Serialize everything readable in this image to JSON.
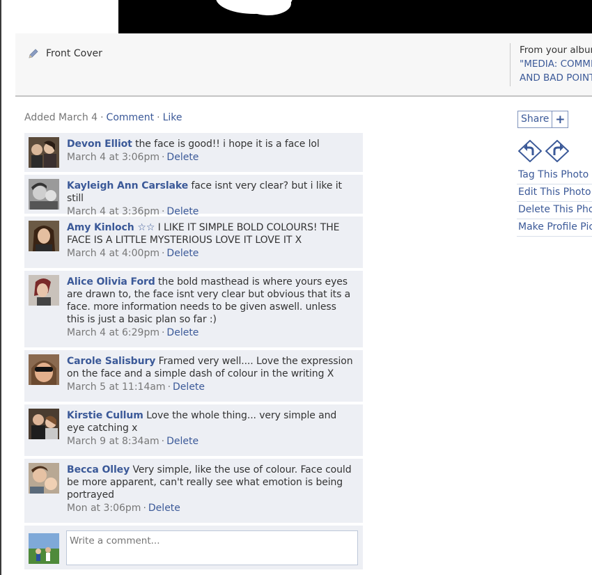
{
  "caption": {
    "text": "Front Cover",
    "icon": "pencil-icon"
  },
  "album": {
    "from_label": "From your album",
    "name_line1": "\"MEDIA: COMMENTS",
    "name_line2": "AND BAD POINTS"
  },
  "meta": {
    "added": "Added March 4",
    "comment_link": "Comment",
    "like_link": "Like",
    "separator": "·"
  },
  "comments": [
    {
      "author": "Devon Elliot",
      "text": " the face is good!! i hope it is a face lol",
      "time": "March 4 at 3:06pm",
      "delete": "Delete"
    },
    {
      "author": "Kayleigh Ann Carslake",
      "text": " face isnt very clear? but i like it still",
      "time": "March 4 at 3:36pm",
      "delete": "Delete"
    },
    {
      "author": "Amy Kinloch ☆☆",
      "text": " I LIKE IT SIMPLE BOLD COLOURS! THE FACE IS A LITTLE MYSTERIOUS LOVE IT LOVE IT X",
      "time": "March 4 at 4:00pm",
      "delete": "Delete"
    },
    {
      "author": "Alice Olivia Ford",
      "text": " the bold masthead is where yours eyes are drawn to, the face isnt very clear but obvious that its a face. more information needs to be given aswell. unless this is just a basic plan so far :)",
      "time": "March 4 at 6:29pm",
      "delete": "Delete"
    },
    {
      "author": "Carole Salisbury",
      "text": " Framed very well.... Love the expression on the face and a simple dash of colour in the writing X",
      "time": "March 5 at 11:14am",
      "delete": "Delete"
    },
    {
      "author": "Kirstie Cullum",
      "text": " Love the whole thing... very simple and eye catching x",
      "time": "March 9 at 8:34am",
      "delete": "Delete"
    },
    {
      "author": "Becca Olley",
      "text": " Very simple, like the use of colour. Face could be more apparent, can't really see what emotion is being portrayed",
      "time": "Mon at 3:06pm",
      "delete": "Delete"
    }
  ],
  "composer": {
    "placeholder": "Write a comment..."
  },
  "share": {
    "label": "Share",
    "plus": "+"
  },
  "actions": {
    "tag": "Tag This Photo",
    "edit": "Edit This Photo",
    "delete": "Delete This Photo",
    "profile": "Make Profile Picture"
  },
  "colors": {
    "link": "#3b5998",
    "comment_bg": "#edeff4",
    "meta": "#777777"
  }
}
